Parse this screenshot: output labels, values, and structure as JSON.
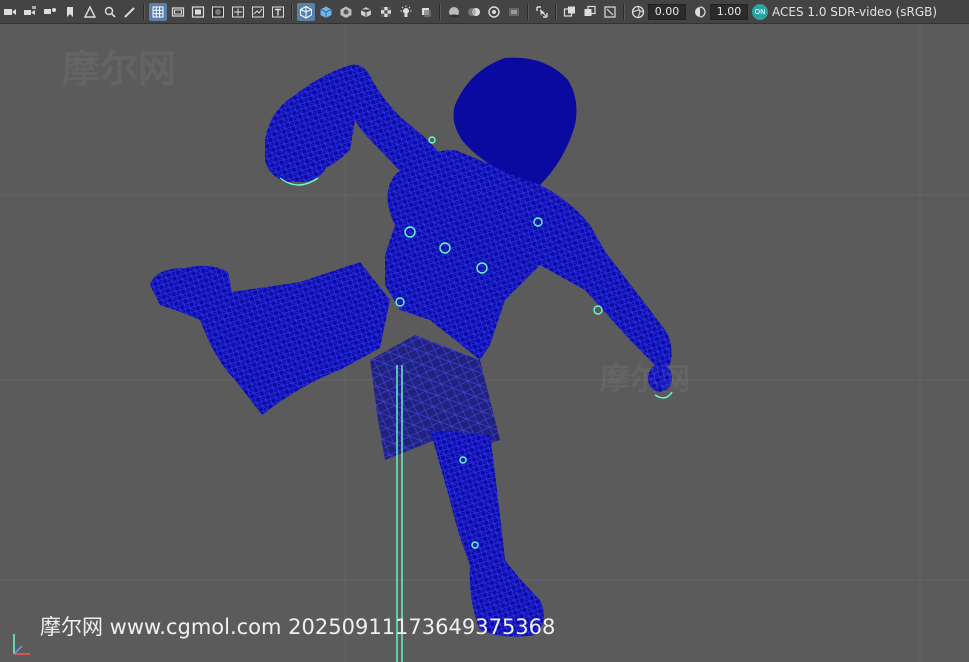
{
  "toolbar": {
    "groups": [
      [
        "camera-icon",
        "camera-attr-icon",
        "bookmark-icon",
        "image-plane-icon",
        "grid-2d-icon",
        "pan-zoom-icon",
        "grease-pencil-icon"
      ],
      [
        "grid-icon",
        "film-gate-icon",
        "resolution-gate-icon",
        "gate-mask-icon",
        "field-chart-icon",
        "safe-action-icon",
        "safe-title-icon"
      ],
      [
        "wireframe-icon",
        "smooth-shade-icon",
        "shade-wireframe-icon",
        "wireframe-on-shaded-icon",
        "textured-icon",
        "lights-icon",
        "shadows-icon"
      ],
      [
        "ambient-occlusion-icon",
        "motion-blur-icon",
        "antialias-icon",
        "depth-of-field-icon"
      ],
      [
        "isolate-icon"
      ],
      [
        "xray-icon",
        "xray-joints-icon",
        "xray-active-icon"
      ],
      [
        "exposure-icon"
      ]
    ],
    "exposure_value": "0.00",
    "gamma_value": "1.00",
    "color_mgmt_badge": "ON",
    "view_transform": "ACES 1.0 SDR-video (sRGB)"
  },
  "viewport": {
    "watermark_text": "摩尔网 www.cgmol.com 20250911173649375368",
    "mesh_color": "#0a0aa8",
    "wire_color": "#1f23d6",
    "joint_color": "#66ffcc",
    "background": "#5b5b5b"
  }
}
